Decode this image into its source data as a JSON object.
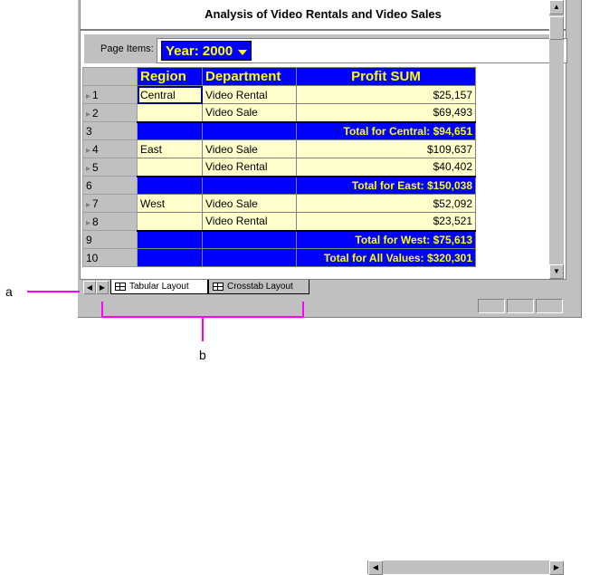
{
  "report": {
    "title": "Analysis of Video Rentals and Video Sales"
  },
  "page_items": {
    "label": "Page Items:",
    "year_value": "Year: 2000"
  },
  "columns": {
    "region": "Region",
    "department": "Department",
    "profit": "Profit SUM"
  },
  "rows": [
    {
      "num": "1",
      "region": "Central",
      "department": "Video Rental",
      "profit": "$25,157",
      "type": "data"
    },
    {
      "num": "2",
      "region": "",
      "department": "Video Sale",
      "profit": "$69,493",
      "type": "data"
    },
    {
      "num": "3",
      "total": "Total for Central: $94,651",
      "type": "total"
    },
    {
      "num": "4",
      "region": "East",
      "department": "Video Sale",
      "profit": "$109,637",
      "type": "data"
    },
    {
      "num": "5",
      "region": "",
      "department": "Video Rental",
      "profit": "$40,402",
      "type": "data"
    },
    {
      "num": "6",
      "total": "Total for East: $150,038",
      "type": "total"
    },
    {
      "num": "7",
      "region": "West",
      "department": "Video Sale",
      "profit": "$52,092",
      "type": "data"
    },
    {
      "num": "8",
      "region": "",
      "department": "Video Rental",
      "profit": "$23,521",
      "type": "data"
    },
    {
      "num": "9",
      "total": "Total for West: $75,613",
      "type": "total"
    },
    {
      "num": "10",
      "total": "Total for All Values: $320,301",
      "type": "total"
    }
  ],
  "tabs": {
    "tabular": "Tabular Layout",
    "crosstab": "Crosstab Layout"
  },
  "callouts": {
    "a": "a",
    "b": "b"
  },
  "colors": {
    "header_bg": "#0000ff",
    "header_text": "#ffff00",
    "cell_bg": "#ffffcc",
    "callout": "#ff00ff"
  }
}
